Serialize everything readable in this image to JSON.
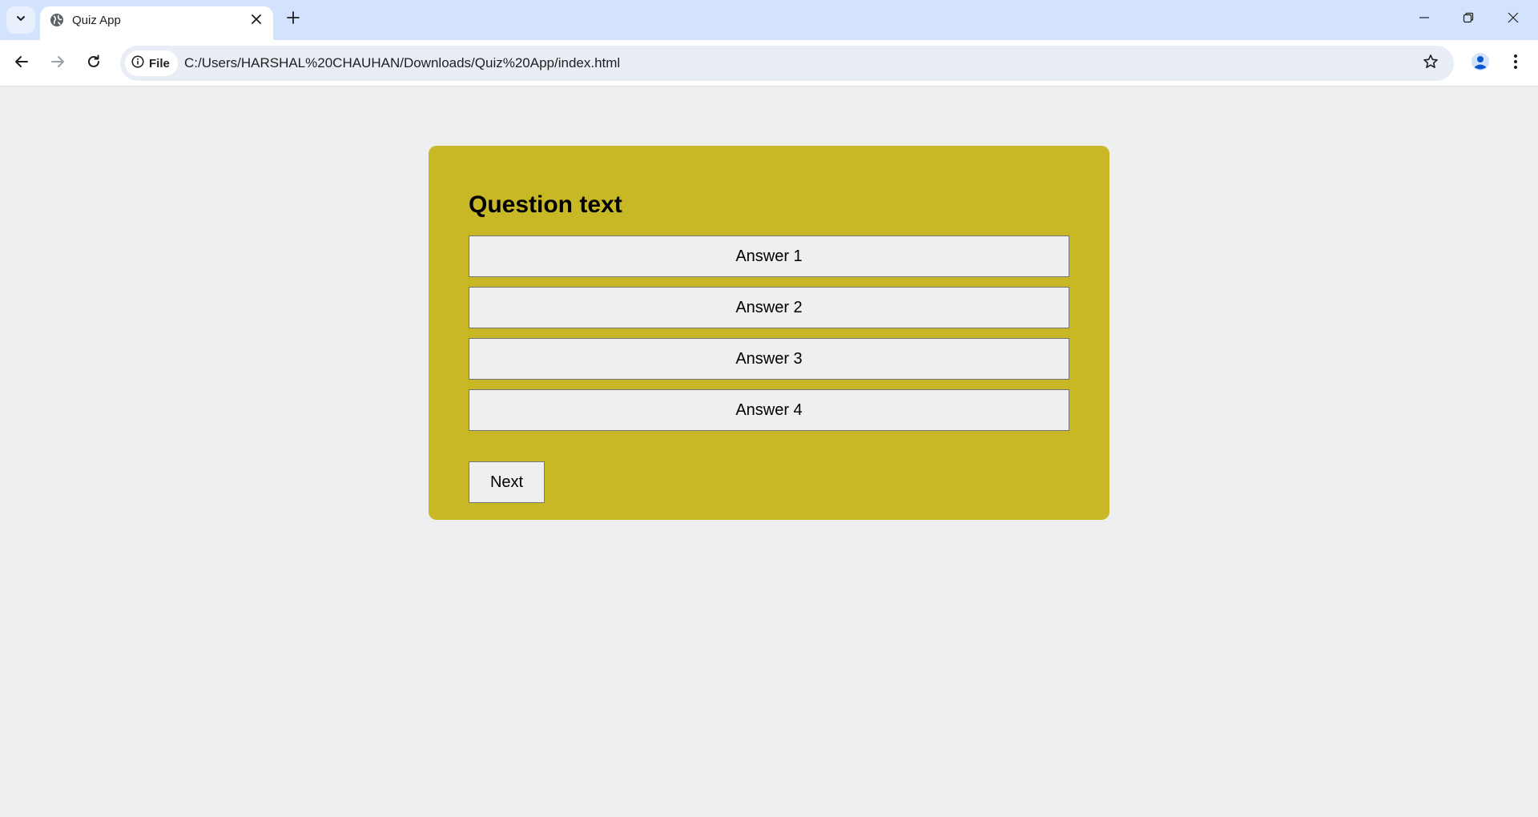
{
  "browser": {
    "tab": {
      "title": "Quiz App"
    },
    "omnibox": {
      "site_chip_label": "File",
      "url": "C:/Users/HARSHAL%20CHAUHAN/Downloads/Quiz%20App/index.html"
    },
    "icons": {
      "tab_search": "chevron-down-icon",
      "favicon": "globe-icon",
      "tab_close": "close-icon",
      "new_tab": "plus-icon",
      "back": "arrow-left-icon",
      "forward": "arrow-right-icon",
      "reload": "reload-icon",
      "site_info": "info-icon",
      "bookmark": "star-icon",
      "profile": "profile-icon",
      "menu": "kebab-menu-icon",
      "minimize": "minimize-icon",
      "restore": "restore-icon",
      "close_window": "close-icon"
    },
    "colors": {
      "tabstrip": "#d3e3fd",
      "omnibox": "#e9eef6",
      "profile_accent": "#0b57d0"
    }
  },
  "quiz": {
    "question": "Question text",
    "answers": [
      "Answer 1",
      "Answer 2",
      "Answer 3",
      "Answer 4"
    ],
    "next_label": "Next",
    "colors": {
      "card": "#c8b825",
      "page_background": "#efefef",
      "button_background": "#efefef"
    }
  }
}
